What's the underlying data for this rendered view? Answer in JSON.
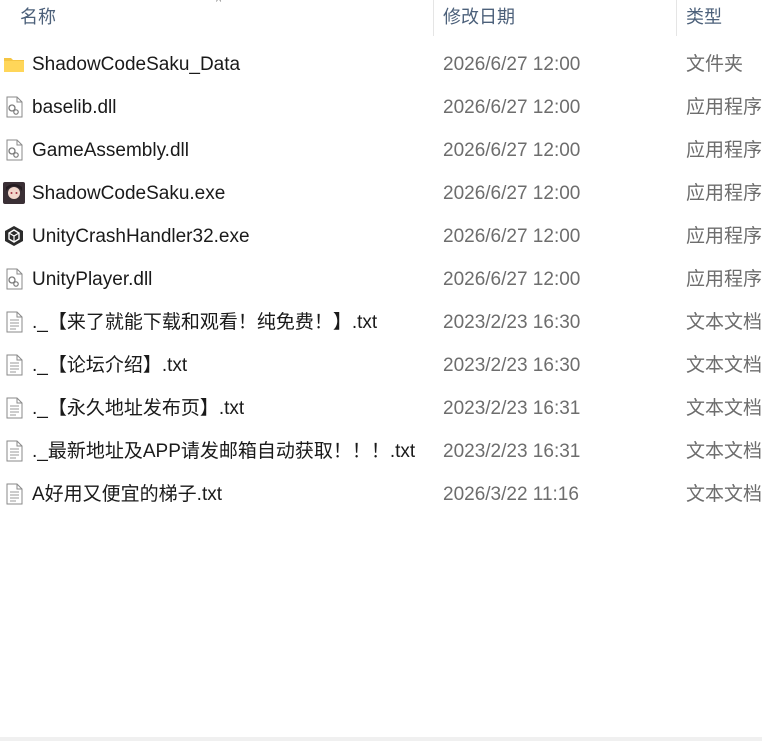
{
  "columns": {
    "name": "名称",
    "date_modified": "修改日期",
    "type": "类型"
  },
  "files": [
    {
      "name": "ShadowCodeSaku_Data",
      "date": "2026/6/27 12:00",
      "type": "文件夹",
      "icon": "folder-icon"
    },
    {
      "name": "baselib.dll",
      "date": "2026/6/27 12:00",
      "type": "应用程序扩",
      "icon": "dll-file-icon"
    },
    {
      "name": "GameAssembly.dll",
      "date": "2026/6/27 12:00",
      "type": "应用程序扩",
      "icon": "dll-file-icon"
    },
    {
      "name": "ShadowCodeSaku.exe",
      "date": "2026/6/27 12:00",
      "type": "应用程序",
      "icon": "game-exe-icon"
    },
    {
      "name": "UnityCrashHandler32.exe",
      "date": "2026/6/27 12:00",
      "type": "应用程序",
      "icon": "unity-icon"
    },
    {
      "name": "UnityPlayer.dll",
      "date": "2026/6/27 12:00",
      "type": "应用程序扩",
      "icon": "dll-file-icon"
    },
    {
      "name": "._【来了就能下载和观看！纯免费！】.txt",
      "date": "2023/2/23 16:30",
      "type": "文本文档",
      "icon": "text-file-icon"
    },
    {
      "name": "._【论坛介绍】.txt",
      "date": "2023/2/23 16:30",
      "type": "文本文档",
      "icon": "text-file-icon"
    },
    {
      "name": "._【永久地址发布页】.txt",
      "date": "2023/2/23 16:31",
      "type": "文本文档",
      "icon": "text-file-icon"
    },
    {
      "name": "._最新地址及APP请发邮箱自动获取！！！.txt",
      "date": "2023/2/23 16:31",
      "type": "文本文档",
      "icon": "text-file-icon"
    },
    {
      "name": "A好用又便宜的梯子.txt",
      "date": "2026/3/22 11:16",
      "type": "文本文档",
      "icon": "text-file-icon"
    }
  ]
}
